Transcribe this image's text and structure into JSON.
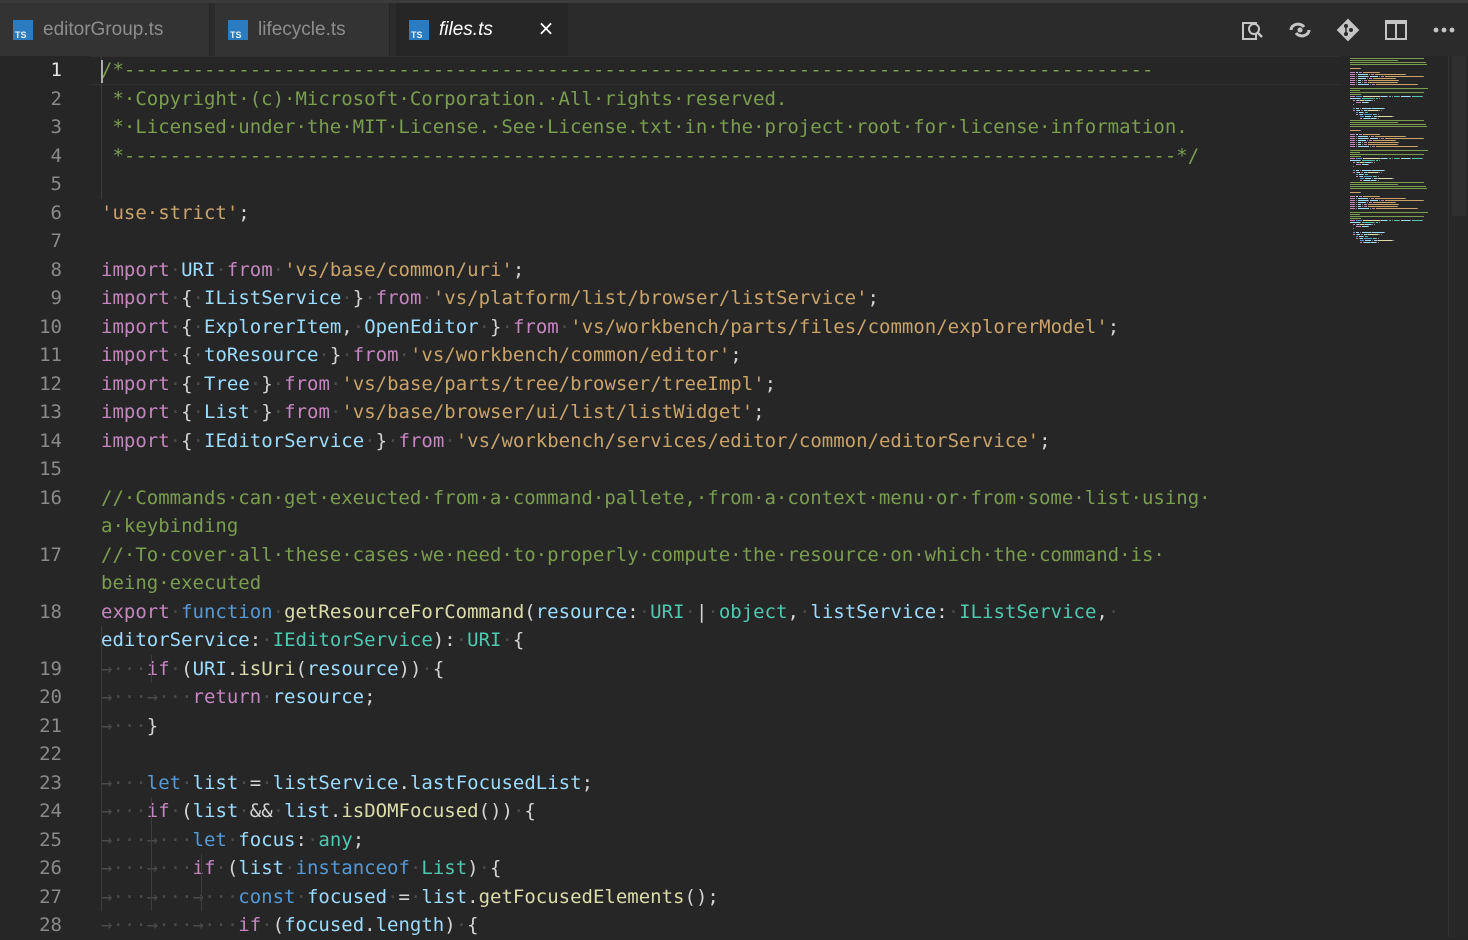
{
  "tabs": [
    {
      "label": "editorGroup.ts",
      "icon": "ts-file-icon",
      "icon_text": "TS",
      "active": false
    },
    {
      "label": "lifecycle.ts",
      "icon": "ts-file-icon",
      "icon_text": "TS",
      "active": false
    },
    {
      "label": "files.ts",
      "icon": "ts-file-icon",
      "icon_text": "TS",
      "active": true,
      "close": "×"
    }
  ],
  "actions": [
    "open-changes-icon",
    "go-to-next-change-icon",
    "git-icon",
    "split-editor-icon",
    "more-actions-icon"
  ],
  "editor": {
    "line_numbers": [
      "1",
      "2",
      "3",
      "4",
      "5",
      "6",
      "7",
      "8",
      "9",
      "10",
      "11",
      "12",
      "13",
      "14",
      "15",
      "16",
      "",
      "17",
      "",
      "18",
      "",
      "19",
      "20",
      "21",
      "22",
      "23",
      "24",
      "25",
      "26",
      "27",
      "28"
    ],
    "lines": [
      [
        [
          "c-com",
          "/*------------------------------------------------------------------------------------------"
        ]
      ],
      [
        [
          "c-com",
          " *·Copyright·(c)·Microsoft·Corporation.·All·rights·reserved."
        ]
      ],
      [
        [
          "c-com",
          " *·Licensed·under·the·MIT·License.·See·License.txt·in·the·project·root·for·license·information."
        ]
      ],
      [
        [
          "c-com",
          " *--------------------------------------------------------------------------------------------*/"
        ]
      ],
      [],
      [
        [
          "c-str",
          "'use·strict'"
        ],
        [
          "c-pl",
          ";"
        ]
      ],
      [],
      [
        [
          "c-kw2",
          "import"
        ],
        [
          "ws",
          "·"
        ],
        [
          "c-var",
          "URI"
        ],
        [
          "ws",
          "·"
        ],
        [
          "c-kw2",
          "from"
        ],
        [
          "ws",
          "·"
        ],
        [
          "c-str",
          "'vs/base/common/uri'"
        ],
        [
          "c-pl",
          ";"
        ]
      ],
      [
        [
          "c-kw2",
          "import"
        ],
        [
          "ws",
          "·"
        ],
        [
          "c-pl",
          "{"
        ],
        [
          "ws",
          "·"
        ],
        [
          "c-var",
          "IListService"
        ],
        [
          "ws",
          "·"
        ],
        [
          "c-pl",
          "}"
        ],
        [
          "ws",
          "·"
        ],
        [
          "c-kw2",
          "from"
        ],
        [
          "ws",
          "·"
        ],
        [
          "c-str",
          "'vs/platform/list/browser/listService'"
        ],
        [
          "c-pl",
          ";"
        ]
      ],
      [
        [
          "c-kw2",
          "import"
        ],
        [
          "ws",
          "·"
        ],
        [
          "c-pl",
          "{"
        ],
        [
          "ws",
          "·"
        ],
        [
          "c-var",
          "ExplorerItem"
        ],
        [
          "c-pl",
          ","
        ],
        [
          "ws",
          "·"
        ],
        [
          "c-var",
          "OpenEditor"
        ],
        [
          "ws",
          "·"
        ],
        [
          "c-pl",
          "}"
        ],
        [
          "ws",
          "·"
        ],
        [
          "c-kw2",
          "from"
        ],
        [
          "ws",
          "·"
        ],
        [
          "c-str",
          "'vs/workbench/parts/files/common/explorerModel'"
        ],
        [
          "c-pl",
          ";"
        ]
      ],
      [
        [
          "c-kw2",
          "import"
        ],
        [
          "ws",
          "·"
        ],
        [
          "c-pl",
          "{"
        ],
        [
          "ws",
          "·"
        ],
        [
          "c-var",
          "toResource"
        ],
        [
          "ws",
          "·"
        ],
        [
          "c-pl",
          "}"
        ],
        [
          "ws",
          "·"
        ],
        [
          "c-kw2",
          "from"
        ],
        [
          "ws",
          "·"
        ],
        [
          "c-str",
          "'vs/workbench/common/editor'"
        ],
        [
          "c-pl",
          ";"
        ]
      ],
      [
        [
          "c-kw2",
          "import"
        ],
        [
          "ws",
          "·"
        ],
        [
          "c-pl",
          "{"
        ],
        [
          "ws",
          "·"
        ],
        [
          "c-var",
          "Tree"
        ],
        [
          "ws",
          "·"
        ],
        [
          "c-pl",
          "}"
        ],
        [
          "ws",
          "·"
        ],
        [
          "c-kw2",
          "from"
        ],
        [
          "ws",
          "·"
        ],
        [
          "c-str",
          "'vs/base/parts/tree/browser/treeImpl'"
        ],
        [
          "c-pl",
          ";"
        ]
      ],
      [
        [
          "c-kw2",
          "import"
        ],
        [
          "ws",
          "·"
        ],
        [
          "c-pl",
          "{"
        ],
        [
          "ws",
          "·"
        ],
        [
          "c-var",
          "List"
        ],
        [
          "ws",
          "·"
        ],
        [
          "c-pl",
          "}"
        ],
        [
          "ws",
          "·"
        ],
        [
          "c-kw2",
          "from"
        ],
        [
          "ws",
          "·"
        ],
        [
          "c-str",
          "'vs/base/browser/ui/list/listWidget'"
        ],
        [
          "c-pl",
          ";"
        ]
      ],
      [
        [
          "c-kw2",
          "import"
        ],
        [
          "ws",
          "·"
        ],
        [
          "c-pl",
          "{"
        ],
        [
          "ws",
          "·"
        ],
        [
          "c-var",
          "IEditorService"
        ],
        [
          "ws",
          "·"
        ],
        [
          "c-pl",
          "}"
        ],
        [
          "ws",
          "·"
        ],
        [
          "c-kw2",
          "from"
        ],
        [
          "ws",
          "·"
        ],
        [
          "c-str",
          "'vs/workbench/services/editor/common/editorService'"
        ],
        [
          "c-pl",
          ";"
        ]
      ],
      [],
      [
        [
          "c-com",
          "//·Commands·can·get·exeucted·from·a·command·pallete,·from·a·context·menu·or·from·some·list·using·"
        ]
      ],
      [
        [
          "c-com",
          "a·keybinding"
        ]
      ],
      [
        [
          "c-com",
          "//·To·cover·all·these·cases·we·need·to·properly·compute·the·resource·on·which·the·command·is·"
        ]
      ],
      [
        [
          "c-com",
          "being·executed"
        ]
      ],
      [
        [
          "c-kw2",
          "export"
        ],
        [
          "ws",
          "·"
        ],
        [
          "c-kw",
          "function"
        ],
        [
          "ws",
          "·"
        ],
        [
          "c-fn",
          "getResourceForCommand"
        ],
        [
          "c-pl",
          "("
        ],
        [
          "c-var",
          "resource"
        ],
        [
          "c-pl",
          ":"
        ],
        [
          "ws",
          "·"
        ],
        [
          "c-typ",
          "URI"
        ],
        [
          "ws",
          "·"
        ],
        [
          "c-pl",
          "|"
        ],
        [
          "ws",
          "·"
        ],
        [
          "c-typ",
          "object"
        ],
        [
          "c-pl",
          ","
        ],
        [
          "ws",
          "·"
        ],
        [
          "c-var",
          "listService"
        ],
        [
          "c-pl",
          ":"
        ],
        [
          "ws",
          "·"
        ],
        [
          "c-typ",
          "IListService"
        ],
        [
          "c-pl",
          ","
        ],
        [
          "ws",
          "·"
        ]
      ],
      [
        [
          "c-var",
          "editorService"
        ],
        [
          "c-pl",
          ":"
        ],
        [
          "ws",
          "·"
        ],
        [
          "c-typ",
          "IEditorService"
        ],
        [
          "c-pl",
          "):"
        ],
        [
          "ws",
          "·"
        ],
        [
          "c-typ",
          "URI"
        ],
        [
          "ws",
          "·"
        ],
        [
          "c-pl",
          "{"
        ]
      ],
      [
        [
          "ws",
          "→···"
        ],
        [
          "c-kw2",
          "if"
        ],
        [
          "ws",
          "·"
        ],
        [
          "c-pl",
          "("
        ],
        [
          "c-var",
          "URI"
        ],
        [
          "c-pl",
          "."
        ],
        [
          "c-fn",
          "isUri"
        ],
        [
          "c-pl",
          "("
        ],
        [
          "c-var",
          "resource"
        ],
        [
          "c-pl",
          "))"
        ],
        [
          "ws",
          "·"
        ],
        [
          "c-pl",
          "{"
        ]
      ],
      [
        [
          "ws",
          "→···→···"
        ],
        [
          "c-kw2",
          "return"
        ],
        [
          "ws",
          "·"
        ],
        [
          "c-var",
          "resource"
        ],
        [
          "c-pl",
          ";"
        ]
      ],
      [
        [
          "ws",
          "→···"
        ],
        [
          "c-pl",
          "}"
        ]
      ],
      [],
      [
        [
          "ws",
          "→···"
        ],
        [
          "c-kw",
          "let"
        ],
        [
          "ws",
          "·"
        ],
        [
          "c-var",
          "list"
        ],
        [
          "ws",
          "·"
        ],
        [
          "c-pl",
          "="
        ],
        [
          "ws",
          "·"
        ],
        [
          "c-var",
          "listService"
        ],
        [
          "c-pl",
          "."
        ],
        [
          "c-var",
          "lastFocusedList"
        ],
        [
          "c-pl",
          ";"
        ]
      ],
      [
        [
          "ws",
          "→···"
        ],
        [
          "c-kw2",
          "if"
        ],
        [
          "ws",
          "·"
        ],
        [
          "c-pl",
          "("
        ],
        [
          "c-var",
          "list"
        ],
        [
          "ws",
          "·"
        ],
        [
          "c-pl",
          "&&"
        ],
        [
          "ws",
          "·"
        ],
        [
          "c-var",
          "list"
        ],
        [
          "c-pl",
          "."
        ],
        [
          "c-fn",
          "isDOMFocused"
        ],
        [
          "c-pl",
          "())"
        ],
        [
          "ws",
          "·"
        ],
        [
          "c-pl",
          "{"
        ]
      ],
      [
        [
          "ws",
          "→···→···"
        ],
        [
          "c-kw",
          "let"
        ],
        [
          "ws",
          "·"
        ],
        [
          "c-var",
          "focus"
        ],
        [
          "c-pl",
          ":"
        ],
        [
          "ws",
          "·"
        ],
        [
          "c-typ",
          "any"
        ],
        [
          "c-pl",
          ";"
        ]
      ],
      [
        [
          "ws",
          "→···→···"
        ],
        [
          "c-kw2",
          "if"
        ],
        [
          "ws",
          "·"
        ],
        [
          "c-pl",
          "("
        ],
        [
          "c-var",
          "list"
        ],
        [
          "ws",
          "·"
        ],
        [
          "c-kw",
          "instanceof"
        ],
        [
          "ws",
          "·"
        ],
        [
          "c-typ",
          "List"
        ],
        [
          "c-pl",
          ")"
        ],
        [
          "ws",
          "·"
        ],
        [
          "c-pl",
          "{"
        ]
      ],
      [
        [
          "ws",
          "→···→···→···"
        ],
        [
          "c-kw",
          "const"
        ],
        [
          "ws",
          "·"
        ],
        [
          "c-var",
          "focused"
        ],
        [
          "ws",
          "·"
        ],
        [
          "c-pl",
          "="
        ],
        [
          "ws",
          "·"
        ],
        [
          "c-var",
          "list"
        ],
        [
          "c-pl",
          "."
        ],
        [
          "c-fn",
          "getFocusedElements"
        ],
        [
          "c-pl",
          "();"
        ]
      ],
      [
        [
          "ws",
          "→···→···→···"
        ],
        [
          "c-kw2",
          "if"
        ],
        [
          "ws",
          "·"
        ],
        [
          "c-pl",
          "("
        ],
        [
          "c-var",
          "focused"
        ],
        [
          "c-pl",
          "."
        ],
        [
          "c-var",
          "length"
        ],
        [
          "c-pl",
          ")"
        ],
        [
          "ws",
          "·"
        ],
        [
          "c-pl",
          "{"
        ]
      ]
    ]
  },
  "colors": {
    "background": "#262626",
    "comment": "#7b9d4f",
    "string": "#c9a36a",
    "keyword": "#559ad6",
    "control": "#c586c0",
    "function": "#dcdcaa",
    "variable": "#9cdcfe",
    "type": "#4ec9b0",
    "ts_icon": "#2a7bbf"
  }
}
